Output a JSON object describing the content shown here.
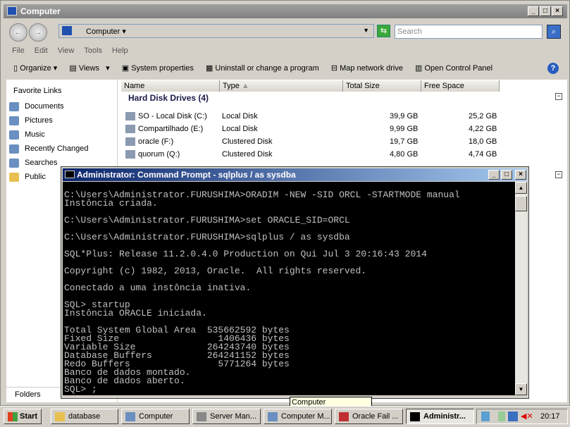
{
  "explorer": {
    "title": "Computer",
    "address": "Computer",
    "search_placeholder": "Search",
    "menu": [
      "File",
      "Edit",
      "View",
      "Tools",
      "Help"
    ],
    "toolbar": {
      "organize": "Organize",
      "views": "Views",
      "system_properties": "System properties",
      "uninstall": "Uninstall or change a program",
      "map_drive": "Map network drive",
      "control_panel": "Open Control Panel"
    },
    "favorites_title": "Favorite Links",
    "favorites": [
      "Documents",
      "Pictures",
      "Music",
      "Recently Changed",
      "Searches",
      "Public"
    ],
    "folders_label": "Folders",
    "columns": [
      "Name",
      "Type",
      "Total Size",
      "Free Space"
    ],
    "group": "Hard Disk Drives (4)",
    "drives": [
      {
        "name": "SO - Local Disk (C:)",
        "type": "Local Disk",
        "total": "39,9 GB",
        "free": "25,2 GB"
      },
      {
        "name": "Compartilhado (E:)",
        "type": "Local Disk",
        "total": "9,99 GB",
        "free": "4,22 GB"
      },
      {
        "name": "oracle (F:)",
        "type": "Clustered Disk",
        "total": "19,7 GB",
        "free": "18,0 GB"
      },
      {
        "name": "quorum (Q:)",
        "type": "Clustered Disk",
        "total": "4,80 GB",
        "free": "4,74 GB"
      }
    ]
  },
  "cmd": {
    "title": "Administrator: Command Prompt - sqlplus  / as sysdba",
    "output": "C:\\Users\\Administrator.FURUSHIMA>ORADIM -NEW -SID ORCL -STARTMODE manual\nInstôncia criada.\n\nC:\\Users\\Administrator.FURUSHIMA>set ORACLE_SID=ORCL\n\nC:\\Users\\Administrator.FURUSHIMA>sqlplus / as sysdba\n\nSQL*Plus: Release 11.2.0.4.0 Production on Qui Jul 3 20:16:43 2014\n\nCopyright (c) 1982, 2013, Oracle.  All rights reserved.\n\nConectado a uma instôncia inativa.\n\nSQL> startup\nInstôncia ORACLE iniciada.\n\nTotal System Global Area  535662592 bytes\nFixed Size                  1406436 bytes\nVariable Size             264243740 bytes\nDatabase Buffers          264241152 bytes\nRedo Buffers                5771264 bytes\nBanco de dados montado.\nBanco de dados aberto.\nSQL> ;"
  },
  "taskbar": {
    "start": "Start",
    "tasks": [
      "database",
      "Computer",
      "Server Man...",
      "Computer M...",
      "Oracle Fail ...",
      "Administr..."
    ],
    "clock": "20:17"
  },
  "tooltip": "Computer Management"
}
